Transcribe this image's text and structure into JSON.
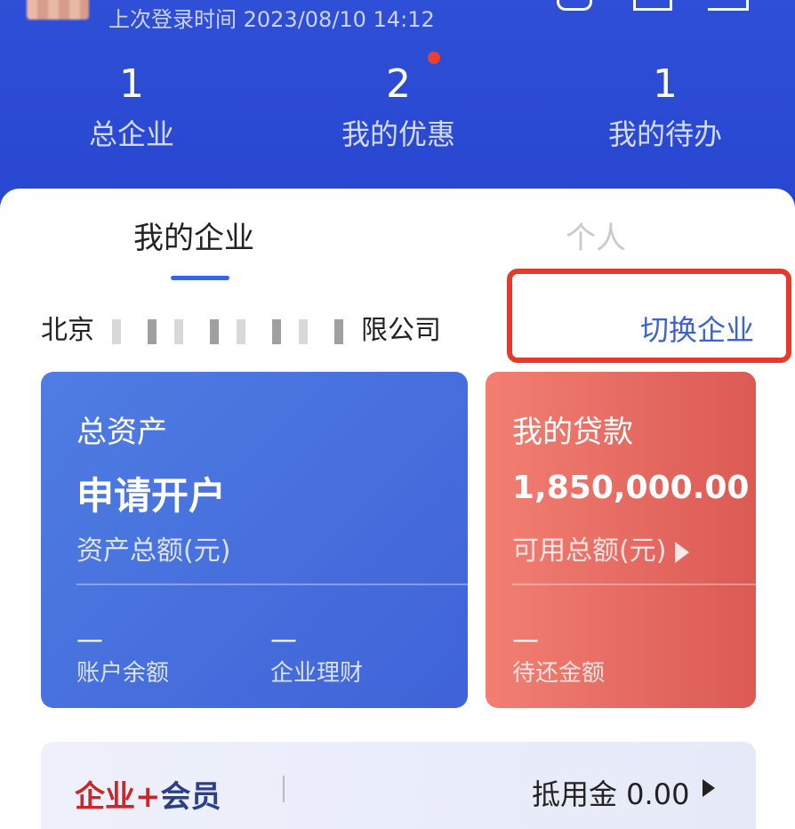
{
  "header": {
    "last_login": "上次登录时间 2023/08/10 14:12",
    "stats": [
      {
        "value": "1",
        "label": "总企业"
      },
      {
        "value": "2",
        "label": "我的优惠"
      },
      {
        "value": "1",
        "label": "我的待办"
      }
    ]
  },
  "tabs": {
    "active": "我的企业",
    "inactive": "个人"
  },
  "company": {
    "prefix": "北京",
    "suffix": "限公司",
    "switch_label": "切换企业"
  },
  "asset_card": {
    "title": "总资产",
    "big": "申请开户",
    "sub": "资产总额(元)",
    "items": [
      {
        "value": "—",
        "label": "账户余额"
      },
      {
        "value": "—",
        "label": "企业理财"
      }
    ]
  },
  "loan_card": {
    "title": "我的贷款",
    "big": "1,850,000.00",
    "sub": "可用总额(元)",
    "items": [
      {
        "value": "—",
        "label": "待还金额"
      }
    ]
  },
  "member": {
    "logo_a": "企业+",
    "logo_b": "会员",
    "value": "抵用金 0.00"
  },
  "colors": {
    "header": "#2f4fd6",
    "accent": "#3b62d6",
    "highlight": "#e53a2b",
    "loan": "#db5a54"
  }
}
